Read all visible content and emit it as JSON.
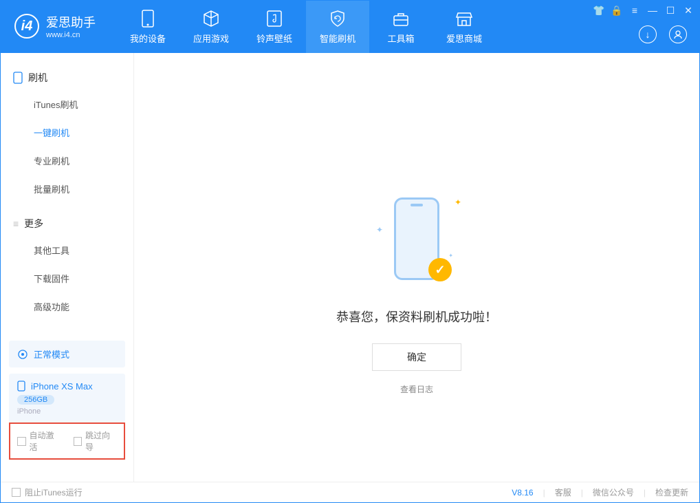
{
  "app": {
    "title": "爱思助手",
    "subtitle": "www.i4.cn"
  },
  "nav": {
    "tabs": [
      {
        "label": "我的设备"
      },
      {
        "label": "应用游戏"
      },
      {
        "label": "铃声壁纸"
      },
      {
        "label": "智能刷机"
      },
      {
        "label": "工具箱"
      },
      {
        "label": "爱思商城"
      }
    ]
  },
  "sidebar": {
    "group1_title": "刷机",
    "group1_items": [
      "iTunes刷机",
      "一键刷机",
      "专业刷机",
      "批量刷机"
    ],
    "group2_title": "更多",
    "group2_items": [
      "其他工具",
      "下载固件",
      "高级功能"
    ]
  },
  "mode": {
    "label": "正常模式"
  },
  "device": {
    "name": "iPhone XS Max",
    "capacity": "256GB",
    "type": "iPhone"
  },
  "checkboxes": {
    "auto_activate": "自动激活",
    "skip_guide": "跳过向导"
  },
  "main": {
    "success_text": "恭喜您，保资料刷机成功啦！",
    "ok_button": "确定",
    "log_link": "查看日志"
  },
  "footer": {
    "block_itunes": "阻止iTunes运行",
    "version": "V8.16",
    "support": "客服",
    "wechat": "微信公众号",
    "update": "检查更新"
  }
}
